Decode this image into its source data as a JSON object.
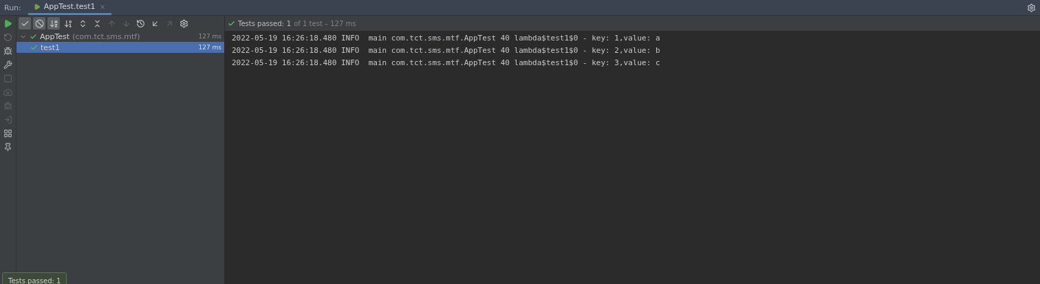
{
  "run_bar": {
    "label": "Run:",
    "tab": {
      "label": "AppTest.test1",
      "selected": true
    }
  },
  "toolbar": [
    {
      "kind": "show-passed",
      "selected": true,
      "disabled": false
    },
    {
      "kind": "show-ignored",
      "selected": true,
      "disabled": false
    },
    {
      "kind": "sort-alpha",
      "selected": true,
      "disabled": false
    },
    {
      "kind": "sort-duration",
      "selected": false,
      "disabled": false
    },
    {
      "kind": "expand-all",
      "selected": false,
      "disabled": false
    },
    {
      "kind": "collapse-all",
      "selected": false,
      "disabled": false
    },
    {
      "kind": "previous",
      "selected": false,
      "disabled": true
    },
    {
      "kind": "next",
      "selected": false,
      "disabled": true
    },
    {
      "kind": "history",
      "selected": false,
      "disabled": false
    },
    {
      "kind": "import",
      "selected": false,
      "disabled": false
    },
    {
      "kind": "export",
      "selected": false,
      "disabled": true
    },
    {
      "kind": "settings",
      "selected": false,
      "disabled": false
    }
  ],
  "status": {
    "label": "Tests passed:",
    "count": "1",
    "detail": "of 1 test – 127 ms",
    "passed": true
  },
  "tree": [
    {
      "label": "AppTest",
      "package": "(com.tct.sms.mtf)",
      "time": "127 ms",
      "expanded": true,
      "selected": false,
      "passed": true,
      "children": [
        {
          "label": "test1",
          "time": "127 ms",
          "selected": true,
          "passed": true
        }
      ]
    }
  ],
  "console": [
    "2022-05-19 16:26:18.480 INFO  main com.tct.sms.mtf.AppTest 40 lambda$test1$0 - key: 1,value: a",
    "2022-05-19 16:26:18.480 INFO  main com.tct.sms.mtf.AppTest 40 lambda$test1$0 - key: 2,value: b",
    "2022-05-19 16:26:18.480 INFO  main com.tct.sms.mtf.AppTest 40 lambda$test1$0 - key: 3,value: c"
  ],
  "toast": {
    "text": "Tests passed: 1"
  }
}
